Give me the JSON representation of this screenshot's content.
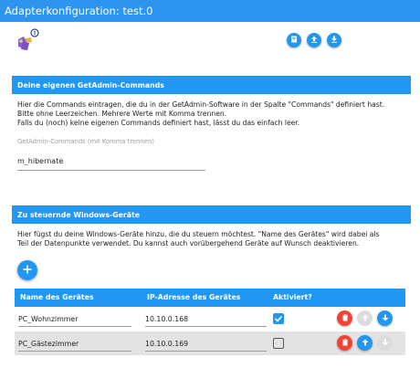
{
  "window": {
    "title": "Adapterkonfiguration: test.0"
  },
  "toolbar": {
    "buttons": [
      {
        "icon": "help-book-icon"
      },
      {
        "icon": "upload-icon"
      },
      {
        "icon": "download-icon"
      }
    ]
  },
  "commands_section": {
    "header": "Deine eigenen GetAdmin-Commands",
    "description": [
      "Hier die Commands eintragen, die du in der GetAdmin-Software in der Spalte \"Commands\" definiert hast.",
      "Bitte ohne Leerzeichen. Mehrere Werte mit Komma trennen.",
      "Falls du (noch) keine eigenen Commands definiert hast, lässt du das einfach leer."
    ],
    "field_label": "GetAdmin-Commands (mit Komma trennen)",
    "field_value": "m_hibernate"
  },
  "devices_section": {
    "header": "Zu steuernde Windows-Geräte",
    "description": [
      "Hier fügst du deine Windows-Geräte hinzu, die du steuern möchtest. \"Name des Gerätes\" wird dabei als",
      "Teil der Datenpunkte verwendet. Du kannst auch vorübergehend Geräte auf Wunsch deaktivieren."
    ],
    "columns": [
      "Name des Gerätes",
      "IP-Adresse des Gerätes",
      "Aktiviert?"
    ],
    "rows": [
      {
        "name": "PC_Wohnzimmer",
        "ip": "10.10.0.168",
        "enabled": true
      },
      {
        "name": "PC_Gästezimmer",
        "ip": "10.10.0.169",
        "enabled": false
      }
    ]
  },
  "colors": {
    "accent": "#2196f3",
    "title_bar": "#2d95f0",
    "delete": "#f44336"
  }
}
